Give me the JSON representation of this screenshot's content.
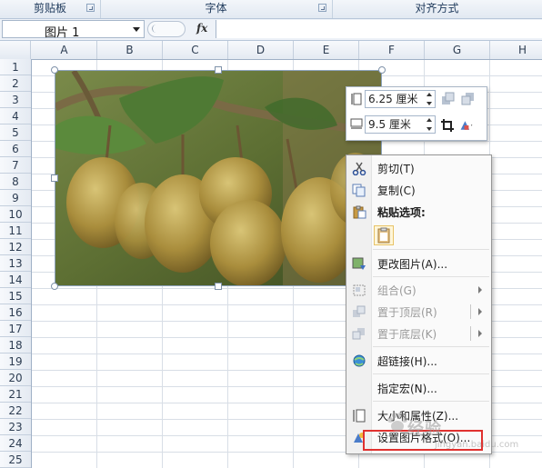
{
  "ribbon": {
    "groups": [
      {
        "label": "剪贴板"
      },
      {
        "label": "字体"
      },
      {
        "label": "对齐方式"
      }
    ]
  },
  "formula_bar": {
    "name_box": "图片 1",
    "fx": "fx",
    "formula": ""
  },
  "columns": [
    "A",
    "B",
    "C",
    "D",
    "E",
    "F",
    "G",
    "H"
  ],
  "rows": [
    "1",
    "2",
    "3",
    "4",
    "5",
    "6",
    "7",
    "8",
    "9",
    "10",
    "11",
    "12",
    "13",
    "14",
    "15",
    "16",
    "17",
    "18",
    "19",
    "20",
    "21",
    "22",
    "23",
    "24",
    "25"
  ],
  "picture": {
    "alt": "kiwi fruit photo"
  },
  "size_toolbar": {
    "height_value": "6.25 厘米",
    "width_value": "9.5 厘米"
  },
  "context_menu": {
    "items": [
      {
        "label": "剪切(T)",
        "icon": "scissors-icon",
        "enabled": true
      },
      {
        "label": "复制(C)",
        "icon": "copy-icon",
        "enabled": true
      },
      {
        "label": "粘贴选项:",
        "icon": "paste-icon",
        "enabled": true,
        "bold": true
      },
      {
        "label": "更改图片(A)...",
        "icon": "change-picture-icon",
        "enabled": true
      },
      {
        "label": "组合(G)",
        "icon": "group-icon",
        "enabled": false,
        "submenu": true
      },
      {
        "label": "置于顶层(R)",
        "icon": "bring-to-front-icon",
        "enabled": false,
        "submenu": true
      },
      {
        "label": "置于底层(K)",
        "icon": "send-to-back-icon",
        "enabled": false,
        "submenu": true
      },
      {
        "label": "超链接(H)...",
        "icon": "hyperlink-icon",
        "enabled": true
      },
      {
        "label": "指定宏(N)...",
        "icon": "",
        "enabled": true
      },
      {
        "label": "大小和属性(Z)...",
        "icon": "size-properties-icon",
        "enabled": true
      },
      {
        "label": "设置图片格式(O)...",
        "icon": "format-picture-icon",
        "enabled": true
      }
    ]
  },
  "watermark": {
    "text": "经验",
    "sub": "jingyan.baidu.com"
  }
}
